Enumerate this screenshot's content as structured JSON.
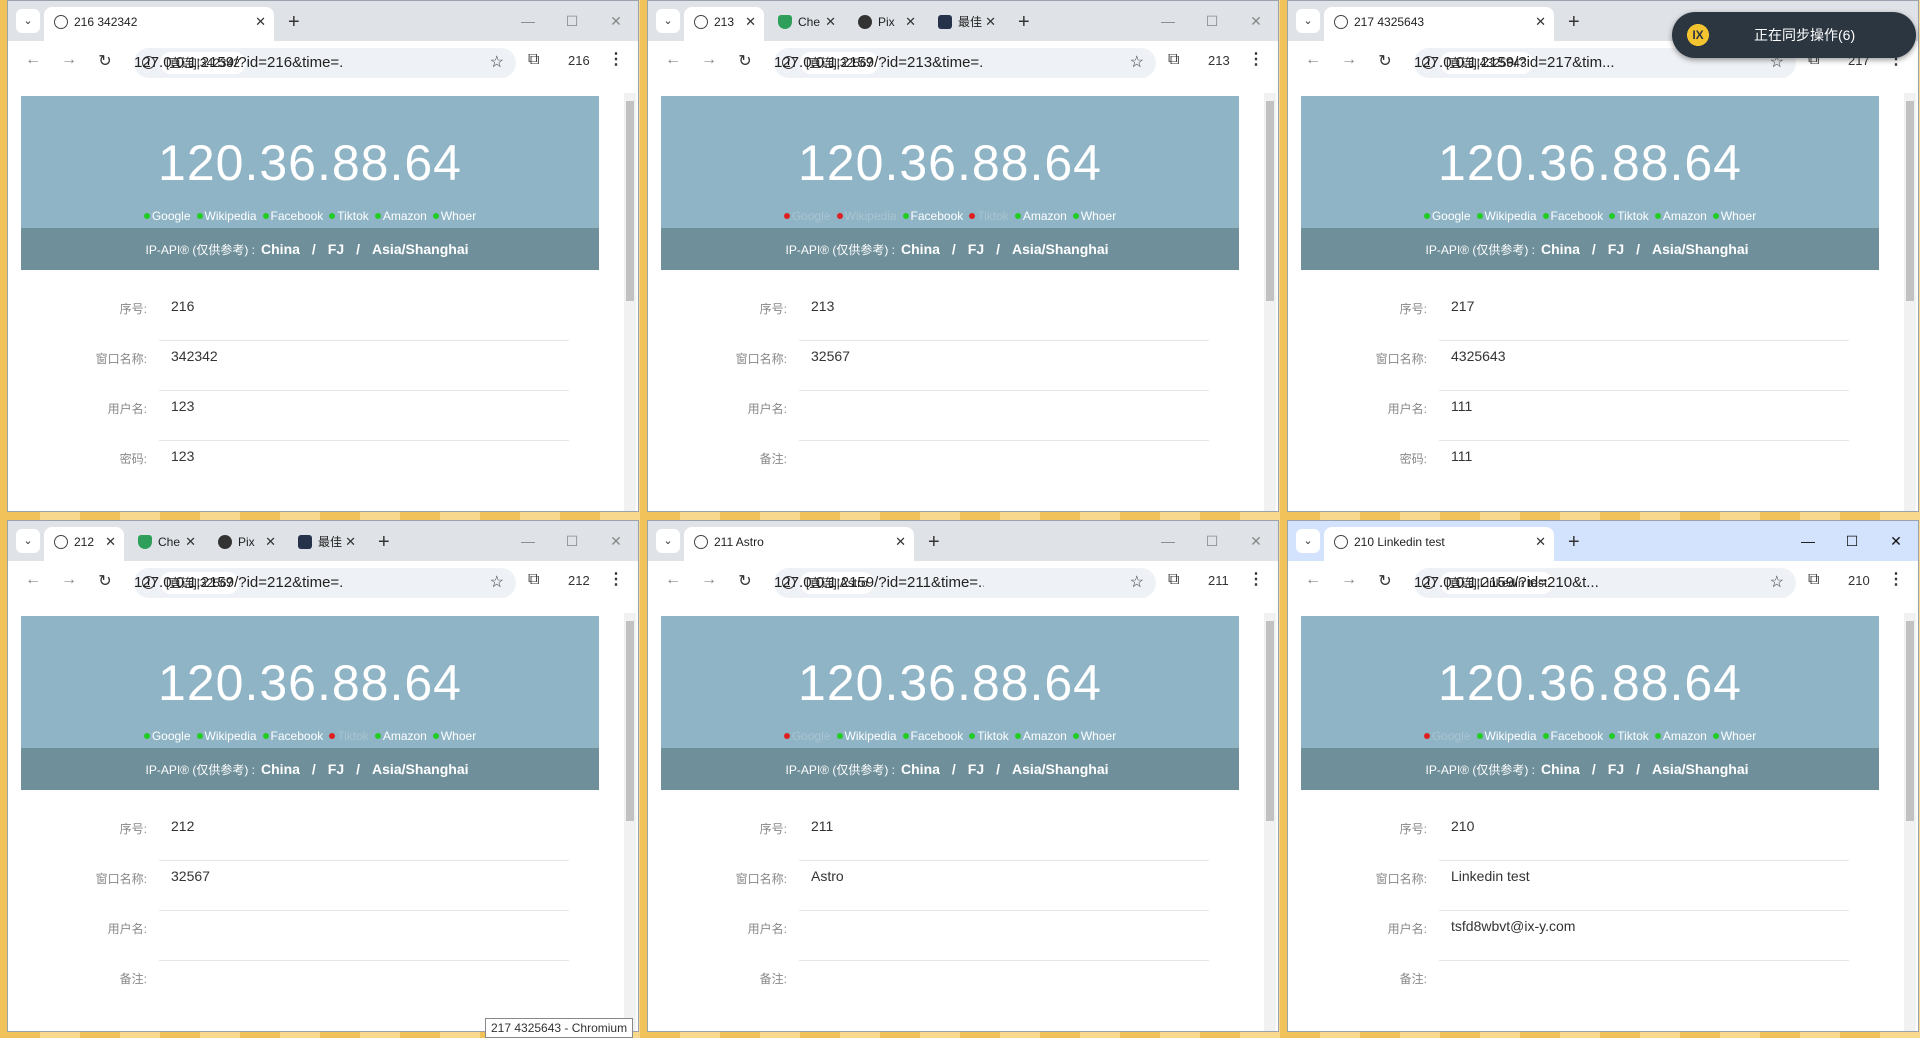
{
  "sync_toast": {
    "text": "正在同步操作(6)"
  },
  "tooltip": {
    "text": "217 4325643 - Chromium"
  },
  "ip": "120.36.88.64",
  "band": {
    "prefix": "IP-API® (仅供参考) :",
    "country": "China",
    "sep1": "/",
    "region": "FJ",
    "sep2": "/",
    "tz": "Asia/Shanghai"
  },
  "labels": {
    "seq": "序号:",
    "win": "窗口名称:",
    "user": "用户名:",
    "pwd": "密码:",
    "note": "备注:"
  },
  "windows": [
    {
      "tabs": [
        {
          "title": "216 342342"
        }
      ],
      "chip": "[直连]|342342",
      "url": "127.0.0.1:2159/?id=216&time=...",
      "badge": "216",
      "links": [
        {
          "name": "Google",
          "ok": true
        },
        {
          "name": "Wikipedia",
          "ok": true
        },
        {
          "name": "Facebook",
          "ok": true
        },
        {
          "name": "Tiktok",
          "ok": true
        },
        {
          "name": "Amazon",
          "ok": true
        },
        {
          "name": "Whoer",
          "ok": true
        }
      ],
      "rows": [
        [
          "seq",
          "216"
        ],
        [
          "win",
          "342342"
        ],
        [
          "user",
          "123"
        ],
        [
          "pwd",
          "123"
        ]
      ]
    },
    {
      "tabs": [
        {
          "title": "213"
        },
        {
          "title": "Che"
        },
        {
          "title": "Pix"
        },
        {
          "title": "最佳"
        }
      ],
      "chip": "[直连]|32567",
      "url": "127.0.0.1:2159/?id=213&time=...",
      "badge": "213",
      "links": [
        {
          "name": "Google",
          "ok": false
        },
        {
          "name": "Wikipedia",
          "ok": false
        },
        {
          "name": "Facebook",
          "ok": true
        },
        {
          "name": "Tiktok",
          "ok": false
        },
        {
          "name": "Amazon",
          "ok": true
        },
        {
          "name": "Whoer",
          "ok": true
        }
      ],
      "rows": [
        [
          "seq",
          "213"
        ],
        [
          "win",
          "32567"
        ],
        [
          "user",
          ""
        ],
        [
          "note",
          ""
        ]
      ]
    },
    {
      "tabs": [
        {
          "title": "217 4325643"
        }
      ],
      "chip": "[直连]|4325643",
      "url": "127.0.0.1:2159/?id=217&tim...",
      "badge": "217",
      "links": [
        {
          "name": "Google",
          "ok": true
        },
        {
          "name": "Wikipedia",
          "ok": true
        },
        {
          "name": "Facebook",
          "ok": true
        },
        {
          "name": "Tiktok",
          "ok": true
        },
        {
          "name": "Amazon",
          "ok": true
        },
        {
          "name": "Whoer",
          "ok": true
        }
      ],
      "rows": [
        [
          "seq",
          "217"
        ],
        [
          "win",
          "4325643"
        ],
        [
          "user",
          "111"
        ],
        [
          "pwd",
          "111"
        ]
      ]
    },
    {
      "tabs": [
        {
          "title": "212"
        },
        {
          "title": "Che"
        },
        {
          "title": "Pix"
        },
        {
          "title": "最佳"
        }
      ],
      "chip": "[直连]|32567",
      "url": "127.0.0.1:2159/?id=212&time=...",
      "badge": "212",
      "links": [
        {
          "name": "Google",
          "ok": true
        },
        {
          "name": "Wikipedia",
          "ok": true
        },
        {
          "name": "Facebook",
          "ok": true
        },
        {
          "name": "Tiktok",
          "ok": false
        },
        {
          "name": "Amazon",
          "ok": true
        },
        {
          "name": "Whoer",
          "ok": true
        }
      ],
      "rows": [
        [
          "seq",
          "212"
        ],
        [
          "win",
          "32567"
        ],
        [
          "user",
          ""
        ],
        [
          "note",
          ""
        ]
      ]
    },
    {
      "tabs": [
        {
          "title": "211 Astro"
        }
      ],
      "chip": "[直连]|Astro",
      "url": "127.0.0.1:2159/?id=211&time=...",
      "badge": "211",
      "links": [
        {
          "name": "Google",
          "ok": false
        },
        {
          "name": "Wikipedia",
          "ok": true
        },
        {
          "name": "Facebook",
          "ok": true
        },
        {
          "name": "Tiktok",
          "ok": true
        },
        {
          "name": "Amazon",
          "ok": true
        },
        {
          "name": "Whoer",
          "ok": true
        }
      ],
      "rows": [
        [
          "seq",
          "211"
        ],
        [
          "win",
          "Astro"
        ],
        [
          "user",
          ""
        ],
        [
          "note",
          ""
        ]
      ]
    },
    {
      "tabs": [
        {
          "title": "210 Linkedin test"
        }
      ],
      "chip": "[直连]|Linkedin test",
      "url": "127.0.0.1:2159/?id=210&t...",
      "badge": "210",
      "links": [
        {
          "name": "Google",
          "ok": false
        },
        {
          "name": "Wikipedia",
          "ok": true
        },
        {
          "name": "Facebook",
          "ok": true
        },
        {
          "name": "Tiktok",
          "ok": true
        },
        {
          "name": "Amazon",
          "ok": true
        },
        {
          "name": "Whoer",
          "ok": true
        }
      ],
      "rows": [
        [
          "seq",
          "210"
        ],
        [
          "win",
          "Linkedin test"
        ],
        [
          "user",
          "tsfd8wbvt@ix-y.com"
        ],
        [
          "note",
          ""
        ]
      ]
    }
  ],
  "colors": {
    "ok": "#22cc22",
    "bad": "#e02020"
  }
}
